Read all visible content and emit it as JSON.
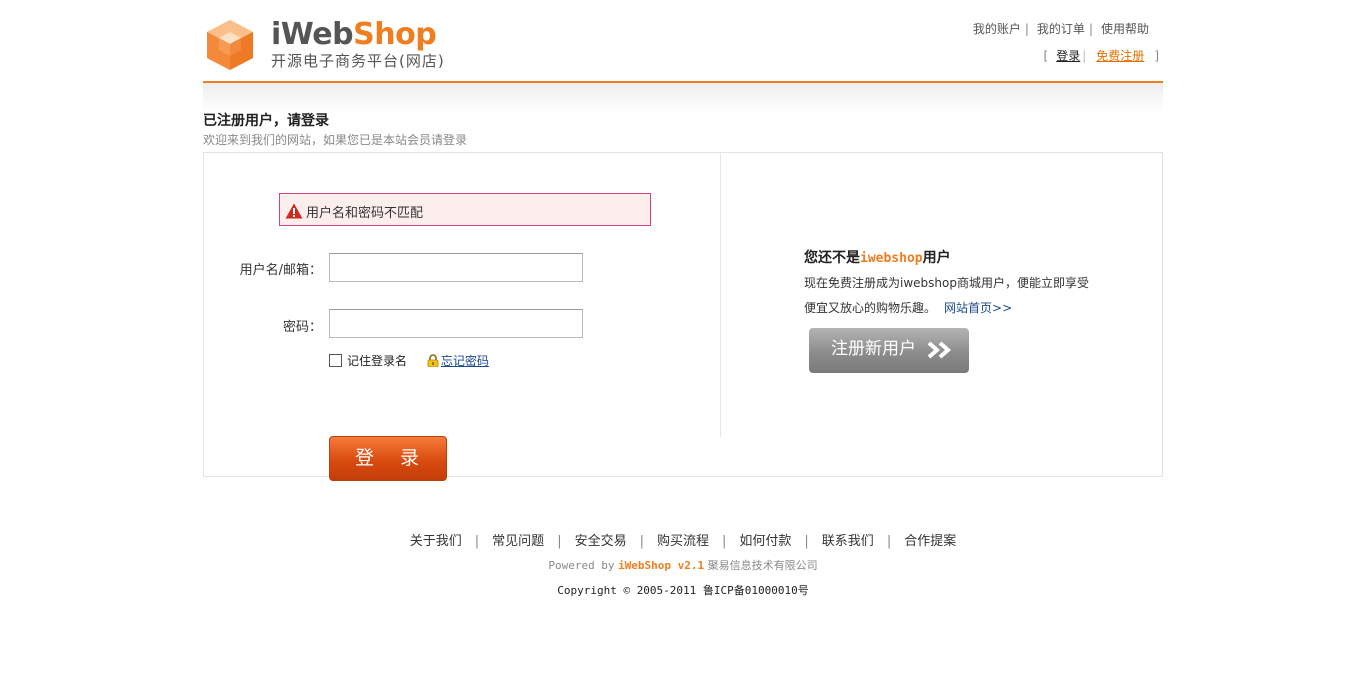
{
  "header": {
    "logo_primary": "iWeb",
    "logo_accent": "Shop",
    "logo_subtitle": "开源电子商务平台(网店)",
    "top_links": [
      "我的账户",
      "我的订单",
      "使用帮助"
    ],
    "auth": {
      "open_bracket": "[",
      "login": "登录",
      "register": "免费注册",
      "close_bracket": "]"
    }
  },
  "page": {
    "title": "已注册用户，请登录",
    "description": "欢迎来到我们的网站，如果您已是本站会员请登录"
  },
  "login_form": {
    "error_message": "用户名和密码不匹配",
    "username_label": "用户名/邮箱：",
    "username_value": "",
    "password_label": "密码：",
    "password_value": "",
    "remember_label": "记住登录名",
    "remember_checked": false,
    "forgot_label": "忘记密码",
    "submit_label": "登 录"
  },
  "register_panel": {
    "title_prefix": "您还不是",
    "title_brand": "iwebshop",
    "title_suffix": "用户",
    "line1": "现在免费注册成为iwebshop商城用户，便能立即享受",
    "line2": "便宜又放心的购物乐趣。",
    "home_link": "网站首页>>",
    "register_button": "注册新用户"
  },
  "footer": {
    "links": [
      "关于我们",
      "常见问题",
      "安全交易",
      "购买流程",
      "如何付款",
      "联系我们",
      "合作提案"
    ],
    "separator": "|",
    "powered_prefix": "Powered by",
    "powered_version": "iWebShop v2.1",
    "powered_company": "聚易信息技术有限公司",
    "copyright": "Copyright © 2005-2011 鲁ICP备01000010号"
  },
  "colors": {
    "brand_orange": "#f07d1e",
    "error_border": "#d9427a",
    "error_background": "#fdeeee",
    "login_button": "#d94b0f",
    "register_button": "#8c8c8c",
    "link_blue": "#1a4a8a"
  },
  "icons": [
    "logo-cube-icon",
    "warning-icon",
    "lock-icon",
    "double-chevron-right-icon"
  ]
}
